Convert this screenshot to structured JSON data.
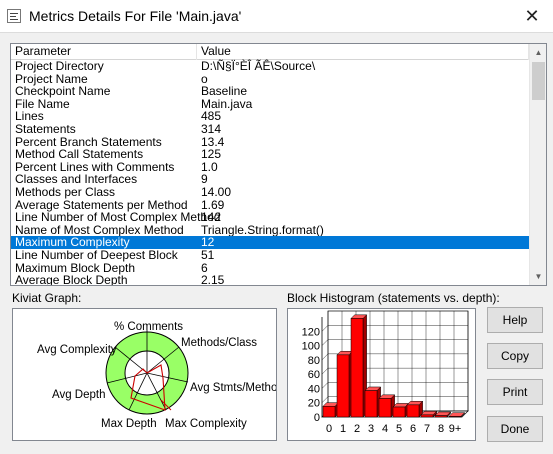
{
  "window": {
    "title": "Metrics Details For File 'Main.java'",
    "close_glyph": "✕"
  },
  "list": {
    "columns": [
      "Parameter",
      "Value"
    ],
    "rows": [
      {
        "param": "Project Directory",
        "value": "D:\\Ñ§Ï°ÈÎ ÃÊ\\Source\\"
      },
      {
        "param": "Project Name",
        "value": "o"
      },
      {
        "param": "Checkpoint Name",
        "value": "Baseline"
      },
      {
        "param": "File Name",
        "value": "Main.java"
      },
      {
        "param": "Lines",
        "value": "485"
      },
      {
        "param": "Statements",
        "value": "314"
      },
      {
        "param": "Percent Branch Statements",
        "value": "13.4"
      },
      {
        "param": "Method Call Statements",
        "value": "125"
      },
      {
        "param": "Percent Lines with Comments",
        "value": "1.0"
      },
      {
        "param": "Classes and Interfaces",
        "value": "9"
      },
      {
        "param": "Methods per Class",
        "value": "14.00"
      },
      {
        "param": "Average Statements per Method",
        "value": "1.69"
      },
      {
        "param": "Line Number of Most Complex Method",
        "value": "142"
      },
      {
        "param": "Name of Most Complex Method",
        "value": "Triangle.String.format()"
      },
      {
        "param": "Maximum Complexity",
        "value": "12",
        "selected": true
      },
      {
        "param": "Line Number of Deepest Block",
        "value": "51"
      },
      {
        "param": "Maximum Block Depth",
        "value": "6"
      },
      {
        "param": "Average Block Depth",
        "value": "2.15"
      }
    ]
  },
  "kiviat": {
    "label": "Kiviat Graph:",
    "axes": [
      "% Comments",
      "Methods/Class",
      "Avg Stmts/Method",
      "Max Complexity",
      "Max Depth",
      "Avg Depth",
      "Avg Complexity"
    ],
    "colors": {
      "outer_ring": "#99ff66",
      "inner_disc": "#ffffff",
      "polygon": "#cc0000"
    }
  },
  "histogram": {
    "label": "Block Histogram (statements vs. depth):",
    "bar_color": "#ff0000"
  },
  "chart_data": {
    "type": "bar",
    "title": "Block Histogram (statements vs. depth):",
    "categories": [
      "0",
      "1",
      "2",
      "3",
      "4",
      "5",
      "6",
      "7",
      "8",
      "9+"
    ],
    "values": [
      15,
      87,
      138,
      37,
      26,
      14,
      17,
      3,
      2,
      1
    ],
    "ylim": [
      0,
      140
    ],
    "yticks": [
      "0",
      "20",
      "40",
      "60",
      "80",
      "100",
      "120"
    ],
    "grid": true
  },
  "buttons": {
    "help": "Help",
    "copy": "Copy",
    "print": "Print",
    "done": "Done"
  }
}
